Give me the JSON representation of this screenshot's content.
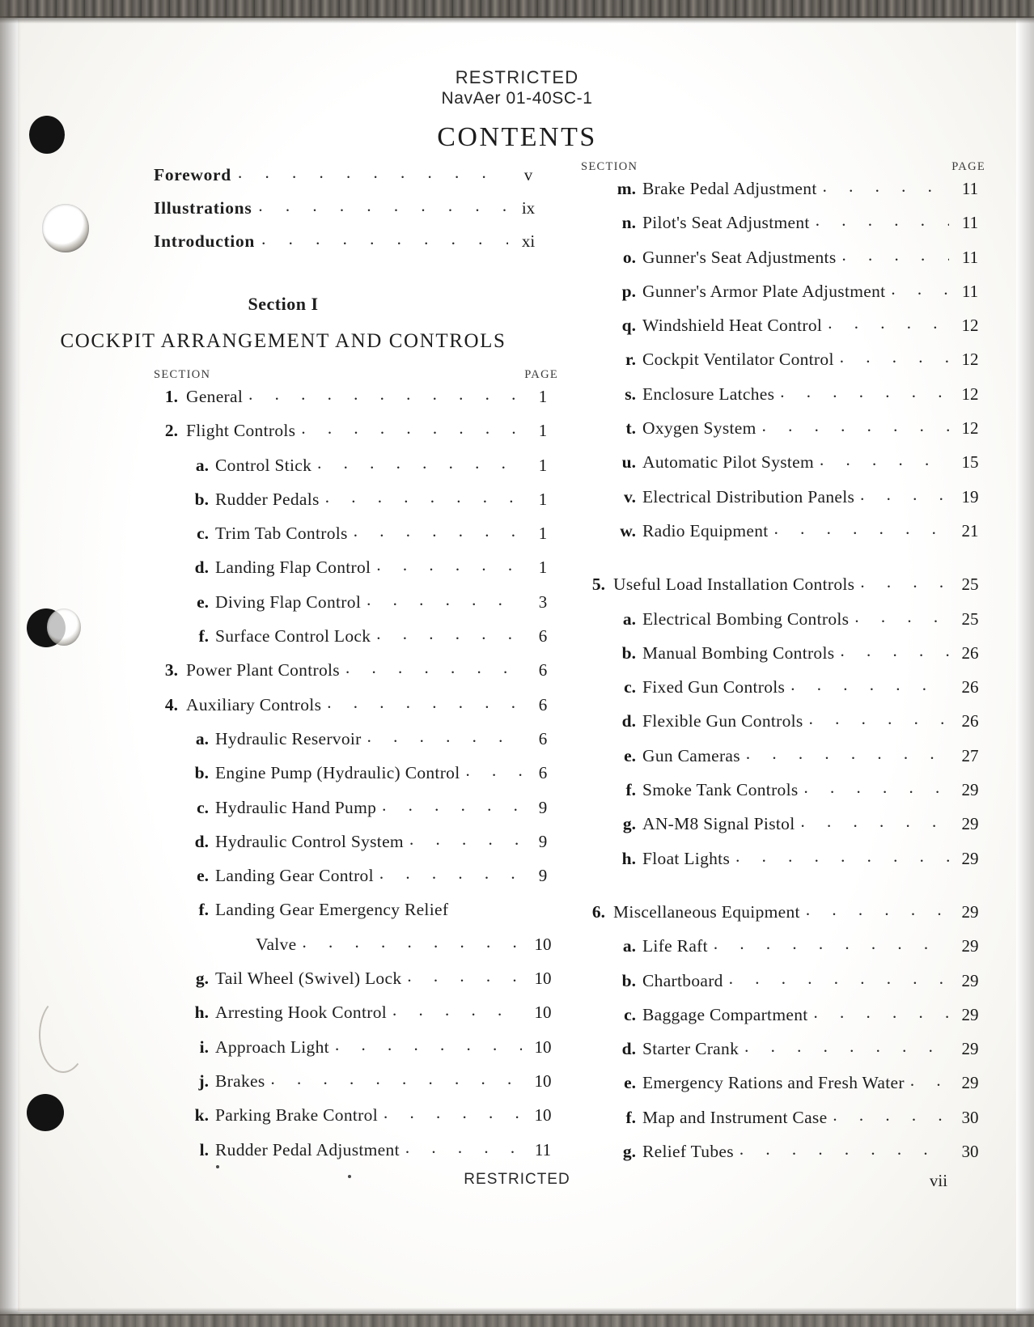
{
  "header": {
    "restricted": "RESTRICTED",
    "navaer_prefix": "N",
    "navaer": "NavAer 01-40SC-1",
    "contents_title": "CONTENTS"
  },
  "front_matter": [
    {
      "label": "Foreword",
      "page": "v"
    },
    {
      "label": "Illustrations",
      "page": "ix"
    },
    {
      "label": "Introduction",
      "page": "xi"
    }
  ],
  "section": {
    "number": "Section I",
    "title": "COCKPIT ARRANGEMENT AND CONTROLS"
  },
  "column_headers": {
    "section": "SECTION",
    "page": "PAGE"
  },
  "left_column": [
    {
      "mark": "1.",
      "text": "General",
      "page": "1",
      "level": 1
    },
    {
      "mark": "2.",
      "text": "Flight  Controls",
      "page": "1",
      "level": 1
    },
    {
      "mark": "a.",
      "text": "Control  Stick",
      "page": "1",
      "level": 2
    },
    {
      "mark": "b.",
      "text": "Rudder  Pedals",
      "page": "1",
      "level": 2
    },
    {
      "mark": "c.",
      "text": "Trim Tab Controls",
      "page": "1",
      "level": 2
    },
    {
      "mark": "d.",
      "text": "Landing Flap Control",
      "page": "1",
      "level": 2
    },
    {
      "mark": "e.",
      "text": "Diving  Flap  Control",
      "page": "3",
      "level": 2
    },
    {
      "mark": "f.",
      "text": "Surface  Control Lock",
      "page": "6",
      "level": 2
    },
    {
      "mark": "3.",
      "text": "Power Plant Controls",
      "page": "6",
      "level": 1
    },
    {
      "mark": "4.",
      "text": "Auxiliary  Controls",
      "page": "6",
      "level": 1
    },
    {
      "mark": "a.",
      "text": "Hydraulic  Reservoir",
      "page": "6",
      "level": 2
    },
    {
      "mark": "b.",
      "text": "Engine Pump (Hydraulic) Control",
      "page": "6",
      "level": 2
    },
    {
      "mark": "c.",
      "text": "Hydraulic  Hand  Pump",
      "page": "9",
      "level": 2
    },
    {
      "mark": "d.",
      "text": "Hydraulic Control System",
      "page": "9",
      "level": 2
    },
    {
      "mark": "e.",
      "text": "Landing  Gear  Control",
      "page": "9",
      "level": 2
    },
    {
      "mark": "f.",
      "text": "Landing Gear Emergency Relief",
      "page": "",
      "level": 2,
      "no_leader": true
    },
    {
      "mark": "",
      "text": "Valve",
      "page": "10",
      "level": 3
    },
    {
      "mark": "g.",
      "text": "Tail Wheel (Swivel) Lock",
      "page": "10",
      "level": 2
    },
    {
      "mark": "h.",
      "text": "Arresting Hook Control",
      "page": "10",
      "level": 2
    },
    {
      "mark": "i.",
      "text": "Approach Light",
      "page": "10",
      "level": 2
    },
    {
      "mark": "j.",
      "text": "Brakes",
      "page": "10",
      "level": 2
    },
    {
      "mark": "k.",
      "text": "Parking Brake Control",
      "page": "10",
      "level": 2
    },
    {
      "mark": "l.",
      "text": "Rudder Pedal Adjustment",
      "page": "11",
      "level": 2
    }
  ],
  "right_column": [
    {
      "mark": "m.",
      "text": "Brake Pedal Adjustment",
      "page": "11",
      "level": 2
    },
    {
      "mark": "n.",
      "text": "Pilot's Seat Adjustment",
      "page": "11",
      "level": 2
    },
    {
      "mark": "o.",
      "text": "Gunner's Seat Adjustments",
      "page": "11",
      "level": 2
    },
    {
      "mark": "p.",
      "text": "Gunner's Armor Plate Adjustment",
      "page": "11",
      "level": 2
    },
    {
      "mark": "q.",
      "text": "Windshield Heat Control",
      "page": "12",
      "level": 2
    },
    {
      "mark": "r.",
      "text": "Cockpit Ventilator Control",
      "page": "12",
      "level": 2
    },
    {
      "mark": "s.",
      "text": "Enclosure  Latches",
      "page": "12",
      "level": 2
    },
    {
      "mark": "t.",
      "text": "Oxygen System",
      "page": "12",
      "level": 2
    },
    {
      "mark": "u.",
      "text": "Automatic  Pilot System",
      "page": "15",
      "level": 2
    },
    {
      "mark": "v.",
      "text": "Electrical  Distribution  Panels",
      "page": "19",
      "level": 2
    },
    {
      "mark": "w.",
      "text": "Radio  Equipment",
      "page": "21",
      "level": 2
    },
    {
      "mark": "5.",
      "text": "Useful Load Installation Controls",
      "page": "25",
      "level": 1,
      "gap_before": true
    },
    {
      "mark": "a.",
      "text": "Electrical Bombing Controls",
      "page": "25",
      "level": 2
    },
    {
      "mark": "b.",
      "text": "Manual Bombing Controls",
      "page": "26",
      "level": 2
    },
    {
      "mark": "c.",
      "text": "Fixed Gun Controls",
      "page": "26",
      "level": 2
    },
    {
      "mark": "d.",
      "text": "Flexible Gun Controls",
      "page": "26",
      "level": 2
    },
    {
      "mark": "e.",
      "text": "Gun  Cameras",
      "page": "27",
      "level": 2
    },
    {
      "mark": "f.",
      "text": "Smoke Tank Controls",
      "page": "29",
      "level": 2
    },
    {
      "mark": "g.",
      "text": "AN-M8 Signal Pistol",
      "page": "29",
      "level": 2
    },
    {
      "mark": "h.",
      "text": "Float Lights",
      "page": "29",
      "level": 2
    },
    {
      "mark": "6.",
      "text": "Miscellaneous Equipment",
      "page": "29",
      "level": 1,
      "gap_before": true
    },
    {
      "mark": "a.",
      "text": "Life Raft",
      "page": "29",
      "level": 2
    },
    {
      "mark": "b.",
      "text": "Chartboard",
      "page": "29",
      "level": 2
    },
    {
      "mark": "c.",
      "text": "Baggage Compartment",
      "page": "29",
      "level": 2
    },
    {
      "mark": "d.",
      "text": "Starter Crank",
      "page": "29",
      "level": 2
    },
    {
      "mark": "e.",
      "text": "Emergency Rations and Fresh Water",
      "page": "29",
      "level": 2
    },
    {
      "mark": "f.",
      "text": "Map and Instrument Case",
      "page": "30",
      "level": 2
    },
    {
      "mark": "g.",
      "text": "Relief Tubes",
      "page": "30",
      "level": 2
    }
  ],
  "footer": {
    "restricted": "RESTRICTED",
    "page_number": "vii"
  },
  "leader_dots": ". . . . . . . . . . . . . . . . . . . . . . . . . . . . . . . . . ."
}
